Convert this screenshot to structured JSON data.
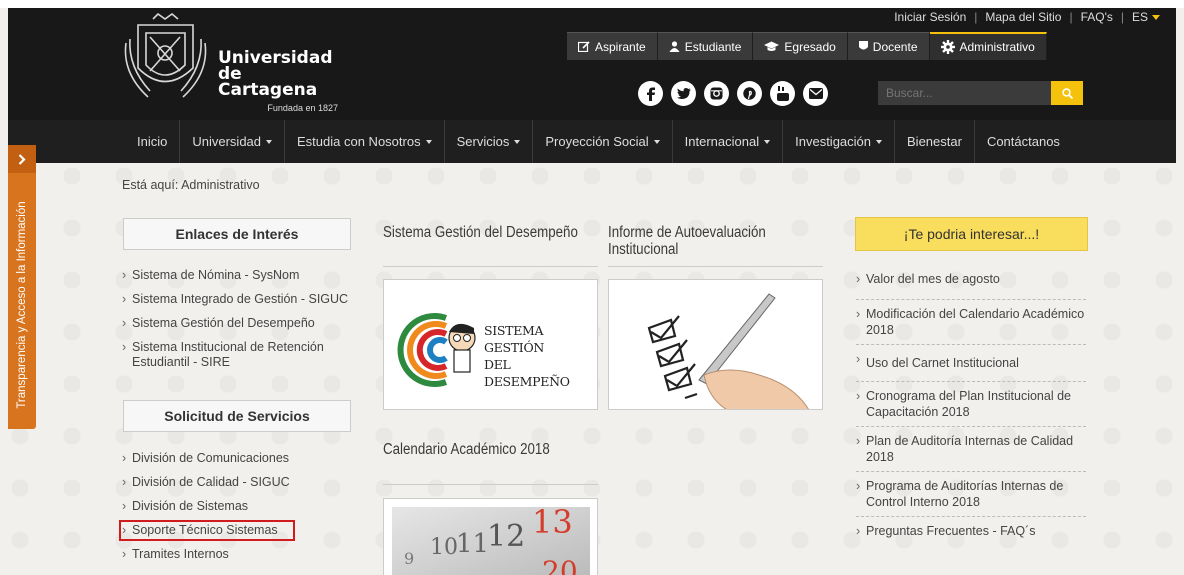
{
  "header": {
    "brand_line1": "Universidad",
    "brand_line2": "de Cartagena",
    "brand_sub": "Fundada en 1827",
    "top_links": [
      "Iniciar Sesión",
      "Mapa del Sitio",
      "FAQ's"
    ],
    "lang": "ES",
    "profiles": [
      "Aspirante",
      "Estudiante",
      "Egresado",
      "Docente",
      "Administrativo"
    ],
    "socials": [
      "facebook-icon",
      "twitter-icon",
      "instagram-icon",
      "pinterest-icon",
      "youtube-icon",
      "mail-icon"
    ],
    "search_placeholder": "Buscar..."
  },
  "nav": {
    "items": [
      "Inicio",
      "Universidad",
      "Estudia con Nosotros",
      "Servicios",
      "Proyección Social",
      "Internacional",
      "Investigación",
      "Bienestar",
      "Contáctanos"
    ]
  },
  "side_tab": {
    "label": "Transparencia y Acceso a la Información"
  },
  "breadcrumb": "Está aquí: Administrativo",
  "enlaces": {
    "title": "Enlaces de Interés",
    "items": [
      "Sistema de Nómina - SysNom",
      "Sistema Integrado de Gestión - SIGUC",
      "Sistema Gestión del Desempeño",
      "Sistema Institucional de Retención Estudiantil - SIRE"
    ]
  },
  "servicios": {
    "title": "Solicitud de Servicios",
    "items": [
      "División de Comunicaciones",
      "División de Calidad - SIGUC",
      "División de Sistemas",
      "Soporte Técnico Sistemas",
      "Tramites Internos"
    ]
  },
  "middle": {
    "sgd_title": "Sistema Gestión del Desempeño",
    "sgd_logo_line1": "SISTEMA GESTIÓN",
    "sgd_logo_line2": "DEL DESEMPEÑO",
    "informe_title": "Informe de Autoevaluación Institucional",
    "calendario_title": "Calendario Académico 2018",
    "cal_numbers": [
      "12",
      "13",
      "10",
      "11",
      "9",
      "20"
    ]
  },
  "interest": {
    "title": "¡Te podria interesar...!",
    "items": [
      "Valor del mes de agosto",
      "Modificación del Calendario Académico 2018",
      "Uso del Carnet Institucional",
      "Cronograma del Plan Institucional de Capacitación 2018",
      "Plan de Auditoría Internas de Calidad 2018",
      "Programa de Auditorías Internas de Control Interno 2018",
      "Preguntas Frecuentes - FAQ´s"
    ]
  },
  "colors": {
    "accent": "#f4c20d",
    "side_tab": "#d9741e",
    "highlight": "#d01c1c"
  }
}
